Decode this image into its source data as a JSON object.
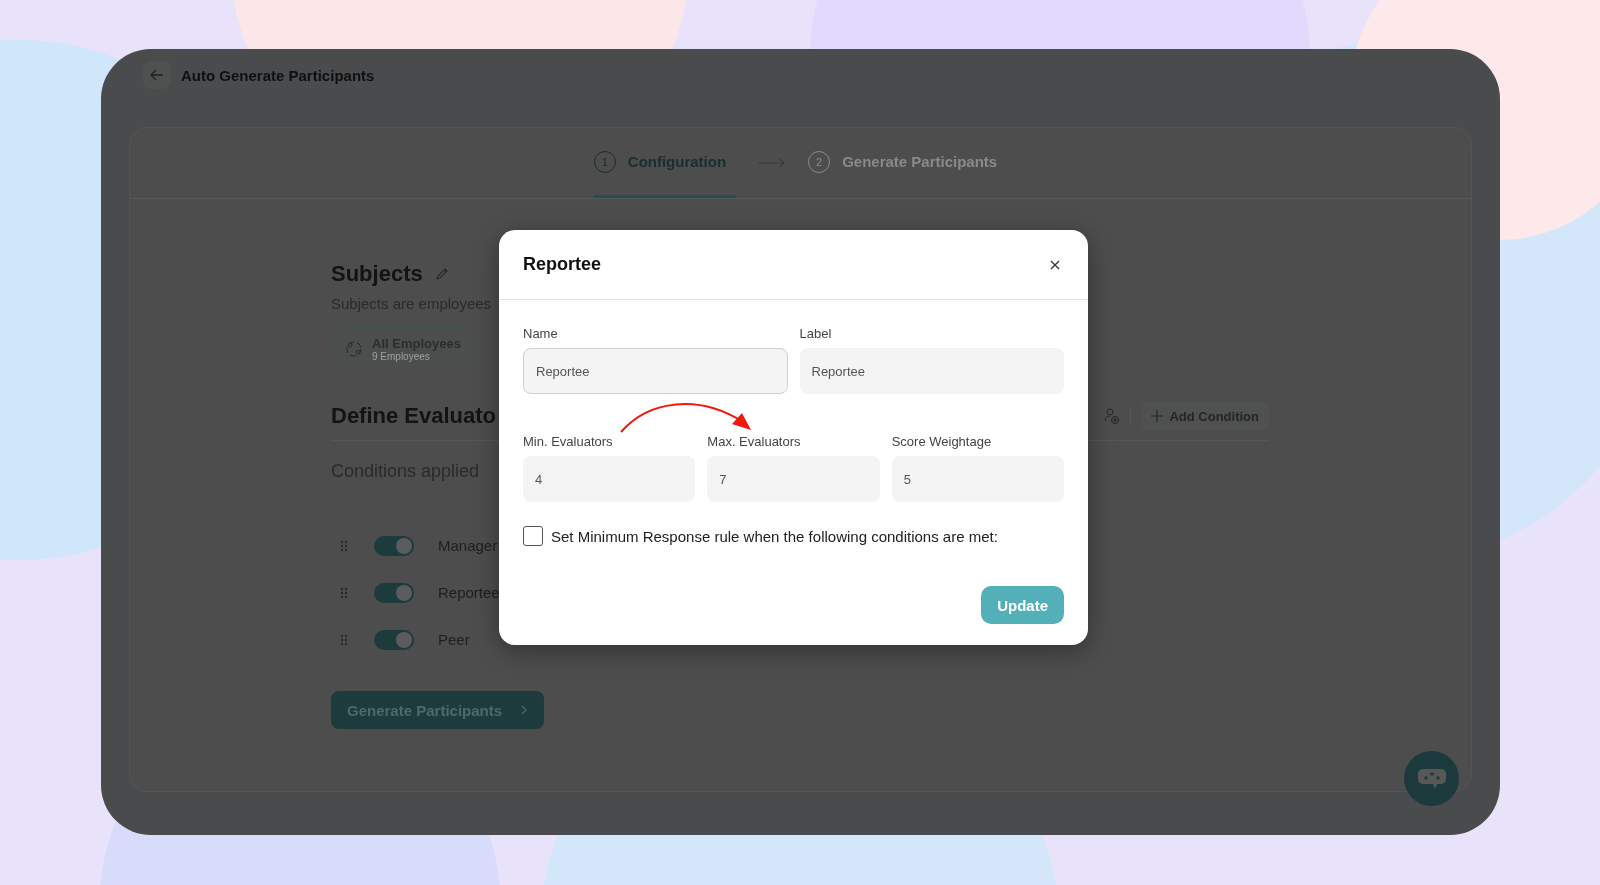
{
  "page": {
    "title": "Auto Generate Participants"
  },
  "steps": [
    {
      "number": "1",
      "label": "Configuration",
      "selected": true
    },
    {
      "number": "2",
      "label": "Generate Participants",
      "selected": false
    }
  ],
  "subjects": {
    "title": "Subjects",
    "description": "Subjects are employees",
    "chip_title": "All Employees",
    "chip_subtitle": "9 Employees"
  },
  "evaluators": {
    "title": "Define Evaluato",
    "add_button": "Add Condition",
    "conditions_label": "Conditions applied",
    "rows": [
      {
        "label": "Manager",
        "on": true
      },
      {
        "label": "Reportee",
        "on": true
      },
      {
        "label": "Peer",
        "on": true
      }
    ]
  },
  "generate_button": "Generate Participants",
  "dialog": {
    "title": "Reportee",
    "fields": [
      {
        "label": "Name",
        "value": "Reportee",
        "kind": "outlined"
      },
      {
        "label": "Label",
        "value": "Reportee",
        "kind": "filled"
      }
    ],
    "number_fields": [
      {
        "label": "Min. Evaluators",
        "value": "4"
      },
      {
        "label": "Max. Evaluators",
        "value": "7"
      },
      {
        "label": "Score Weightage",
        "value": "5"
      }
    ],
    "rule_checkbox": {
      "label": "Set Minimum Response rule when the following conditions are met:",
      "checked": false
    },
    "update_button": "Update"
  }
}
